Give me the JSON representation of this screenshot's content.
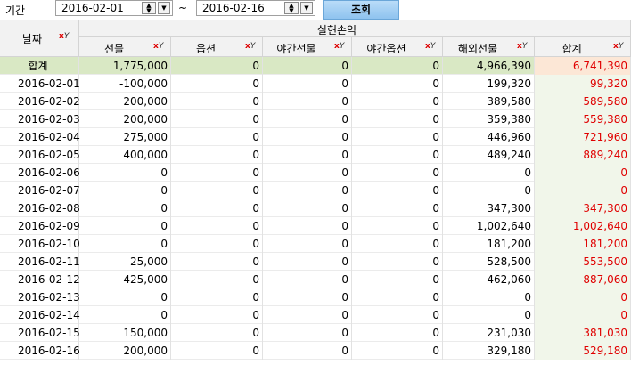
{
  "toolbar": {
    "period_label": "기간",
    "start_date": "2016-02-01",
    "tilde": "~",
    "end_date": "2016-02-16",
    "query_label": "조회"
  },
  "grid": {
    "date_header": "날짜",
    "group_header": "실현손익",
    "columns": [
      "선물",
      "옵션",
      "야간선물",
      "야간옵션",
      "해외선물",
      "합계"
    ],
    "total_row": {
      "label": "합계",
      "values": [
        "1,775,000",
        "0",
        "0",
        "0",
        "4,966,390",
        "6,741,390"
      ]
    },
    "rows": [
      {
        "date": "2016-02-01",
        "values": [
          "-100,000",
          "0",
          "0",
          "0",
          "199,320",
          "99,320"
        ]
      },
      {
        "date": "2016-02-02",
        "values": [
          "200,000",
          "0",
          "0",
          "0",
          "389,580",
          "589,580"
        ]
      },
      {
        "date": "2016-02-03",
        "values": [
          "200,000",
          "0",
          "0",
          "0",
          "359,380",
          "559,380"
        ]
      },
      {
        "date": "2016-02-04",
        "values": [
          "275,000",
          "0",
          "0",
          "0",
          "446,960",
          "721,960"
        ]
      },
      {
        "date": "2016-02-05",
        "values": [
          "400,000",
          "0",
          "0",
          "0",
          "489,240",
          "889,240"
        ]
      },
      {
        "date": "2016-02-06",
        "values": [
          "0",
          "0",
          "0",
          "0",
          "0",
          "0"
        ]
      },
      {
        "date": "2016-02-07",
        "values": [
          "0",
          "0",
          "0",
          "0",
          "0",
          "0"
        ]
      },
      {
        "date": "2016-02-08",
        "values": [
          "0",
          "0",
          "0",
          "0",
          "347,300",
          "347,300"
        ]
      },
      {
        "date": "2016-02-09",
        "values": [
          "0",
          "0",
          "0",
          "0",
          "1,002,640",
          "1,002,640"
        ]
      },
      {
        "date": "2016-02-10",
        "values": [
          "0",
          "0",
          "0",
          "0",
          "181,200",
          "181,200"
        ]
      },
      {
        "date": "2016-02-11",
        "values": [
          "25,000",
          "0",
          "0",
          "0",
          "528,500",
          "553,500"
        ]
      },
      {
        "date": "2016-02-12",
        "values": [
          "425,000",
          "0",
          "0",
          "0",
          "462,060",
          "887,060"
        ]
      },
      {
        "date": "2016-02-13",
        "values": [
          "0",
          "0",
          "0",
          "0",
          "0",
          "0"
        ]
      },
      {
        "date": "2016-02-14",
        "values": [
          "0",
          "0",
          "0",
          "0",
          "0",
          "0"
        ]
      },
      {
        "date": "2016-02-15",
        "values": [
          "150,000",
          "0",
          "0",
          "0",
          "231,030",
          "381,030"
        ]
      },
      {
        "date": "2016-02-16",
        "values": [
          "200,000",
          "0",
          "0",
          "0",
          "329,180",
          "529,180"
        ]
      }
    ]
  },
  "colors": {
    "total_row_bg": "#d9e8c4",
    "sum_text": "#e00000",
    "sum_col_bg": "#f1f6ea",
    "button_bg": "#a9d2f5"
  }
}
